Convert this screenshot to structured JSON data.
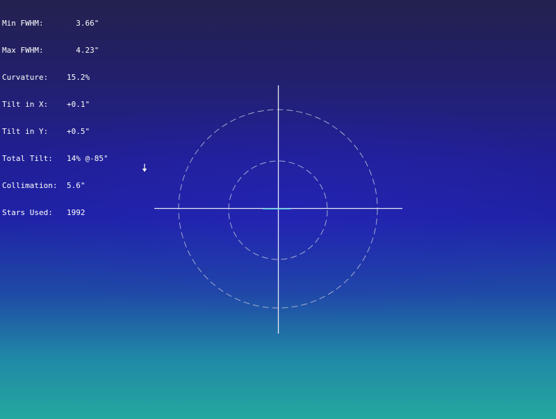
{
  "stats": {
    "min_fwhm": {
      "label": "Min FWHM:",
      "value": "  3.66\""
    },
    "max_fwhm": {
      "label": "Max FWHM:",
      "value": "  4.23\""
    },
    "curvature": {
      "label": "Curvature:",
      "value": "15.2%"
    },
    "tilt_x": {
      "label": "Tilt in X:",
      "value": "+0.1\""
    },
    "tilt_y": {
      "label": "Tilt in Y:",
      "value": "+0.5\""
    },
    "total_tilt": {
      "label": "Total Tilt:",
      "value": "14% @-85°"
    },
    "collimation": {
      "label": "Collimation:",
      "value": "5.6\""
    },
    "stars_used": {
      "label": "Stars Used:",
      "value": "1992"
    }
  },
  "icons": {
    "tilt_direction": "down-arrow-icon"
  },
  "colors": {
    "text": "#ffffff",
    "crosshair": "#e8ecf4",
    "circles": "#b4b9d6",
    "collimation_mark": "#33c6e6"
  }
}
